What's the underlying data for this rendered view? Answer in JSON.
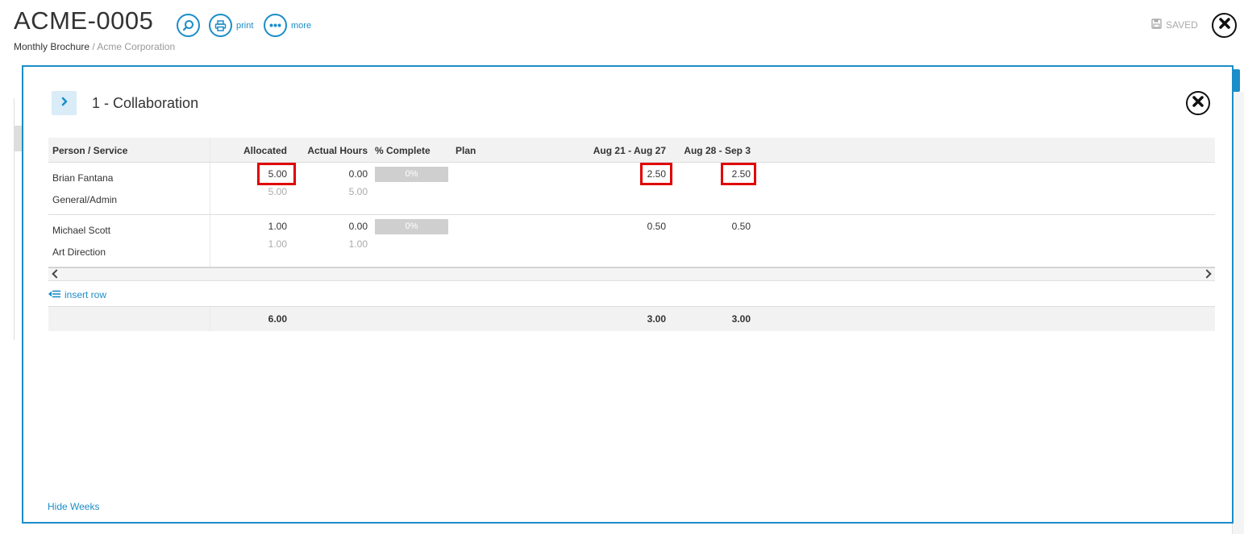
{
  "header": {
    "title": "ACME-0005",
    "print_label": "print",
    "more_label": "more",
    "saved_label": "SAVED",
    "breadcrumb": {
      "project": "Monthly Brochure",
      "separator": "/",
      "client": "Acme Corporation"
    }
  },
  "modal": {
    "title": "1 - Collaboration",
    "columns": {
      "person": "Person / Service",
      "allocated": "Allocated",
      "actual": "Actual Hours",
      "complete": "% Complete",
      "plan": "Plan",
      "week1": "Aug 21 - Aug 27",
      "week2": "Aug 28 - Sep 3"
    },
    "rows": [
      {
        "person": "Brian Fantana",
        "service": "General/Admin",
        "allocated": "5.00",
        "allocated_sub": "5.00",
        "actual": "0.00",
        "actual_sub": "5.00",
        "complete": "0%",
        "week1": "2.50",
        "week2": "2.50"
      },
      {
        "person": "Michael Scott",
        "service": "Art Direction",
        "allocated": "1.00",
        "allocated_sub": "1.00",
        "actual": "0.00",
        "actual_sub": "1.00",
        "complete": "0%",
        "week1": "0.50",
        "week2": "0.50"
      }
    ],
    "insert_row_label": "insert row",
    "totals": {
      "allocated": "6.00",
      "week1": "3.00",
      "week2": "3.00"
    },
    "hide_weeks_label": "Hide Weeks"
  },
  "colors": {
    "accent": "#1b8dc8",
    "highlight": "#e00000"
  },
  "icons": [
    "search-icon",
    "print-icon",
    "more-icon",
    "save-icon",
    "close-icon",
    "chevron-right-icon",
    "insert-row-icon"
  ]
}
